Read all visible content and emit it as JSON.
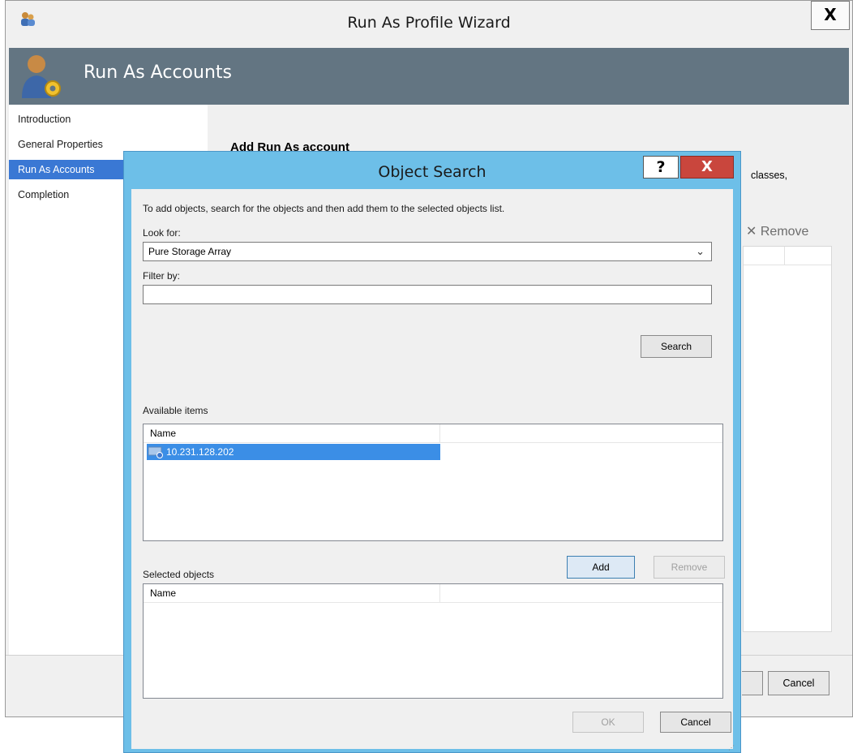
{
  "wizard": {
    "title": "Run As Profile Wizard",
    "close_label": "X",
    "header_title": "Run As Accounts",
    "nav": [
      {
        "label": "Introduction"
      },
      {
        "label": "General Properties"
      },
      {
        "label": "Run As Accounts"
      },
      {
        "label": "Completion"
      }
    ],
    "active_nav_index": 2,
    "content": {
      "heading": "Add Run As account",
      "text_tail": "classes,",
      "remove_label": "Remove"
    },
    "cancel_label": "Cancel"
  },
  "dialog": {
    "title": "Object Search",
    "help_label": "?",
    "close_label": "X",
    "instruction": "To add objects, search for the objects and then add them to the selected objects list.",
    "look_for_label": "Look for:",
    "look_for_value": "Pure Storage Array",
    "filter_label": "Filter by:",
    "filter_value": "",
    "search_label": "Search",
    "available_label": "Available items",
    "available_column": "Name",
    "available_items": [
      {
        "name": "10.231.128.202",
        "selected": true
      }
    ],
    "add_label": "Add",
    "remove_label": "Remove",
    "selected_label": "Selected objects",
    "selected_column": "Name",
    "selected_items": [],
    "ok_label": "OK",
    "cancel_label": "Cancel"
  },
  "colors": {
    "dialog_frame": "#6dbfe8",
    "header_band": "#637582",
    "selection": "#3b8ee6",
    "close_red": "#c9463d"
  },
  "icons": {
    "wizard_title": "users-icon",
    "header": "account-gear-icon",
    "list_item": "storage-array-icon",
    "remove": "x-icon"
  }
}
